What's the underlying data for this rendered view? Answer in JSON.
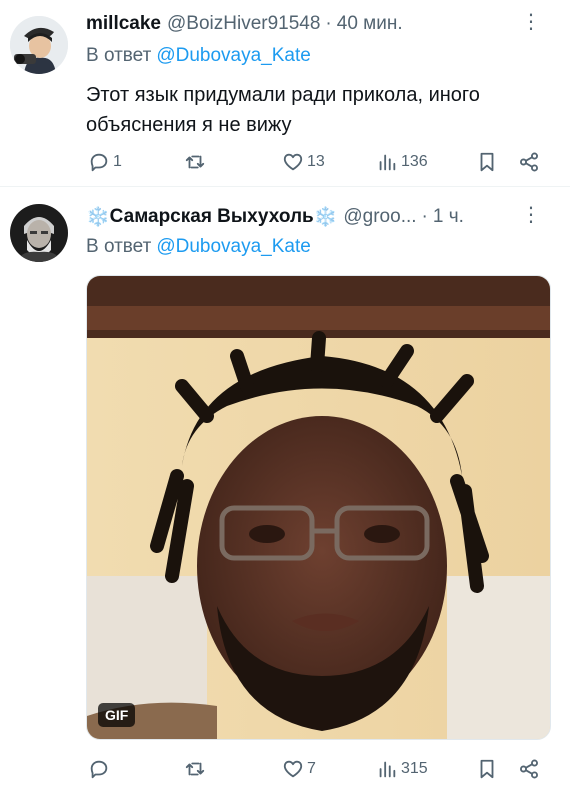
{
  "tweets": [
    {
      "author_name": "millcake",
      "handle": "@BoizHiver91548",
      "separator": "·",
      "time": "40 мин.",
      "reply_label": "В ответ",
      "reply_mention": "@Dubovaya_Kate",
      "text": "Этот язык придумали ради прикола, иного объяснения я не вижу",
      "replies": "1",
      "reposts": "",
      "likes": "13",
      "views": "136"
    },
    {
      "author_name": "Самарская Выхухоль",
      "name_emoji": "❄️",
      "handle": "@groo...",
      "separator": "·",
      "time": "1 ч.",
      "reply_label": "В ответ",
      "reply_mention": "@Dubovaya_Kate",
      "media_badge": "GIF",
      "replies": "",
      "reposts": "",
      "likes": "7",
      "views": "315"
    }
  ],
  "more_icon": "⋮",
  "icons": [
    "more-icon",
    "reply-icon",
    "repost-icon",
    "like-icon",
    "views-icon",
    "bookmark-icon",
    "share-icon"
  ],
  "colors": {
    "link": "#1d9bf0",
    "muted": "#536471",
    "text": "#0f1419",
    "divider": "#eff3f4"
  }
}
